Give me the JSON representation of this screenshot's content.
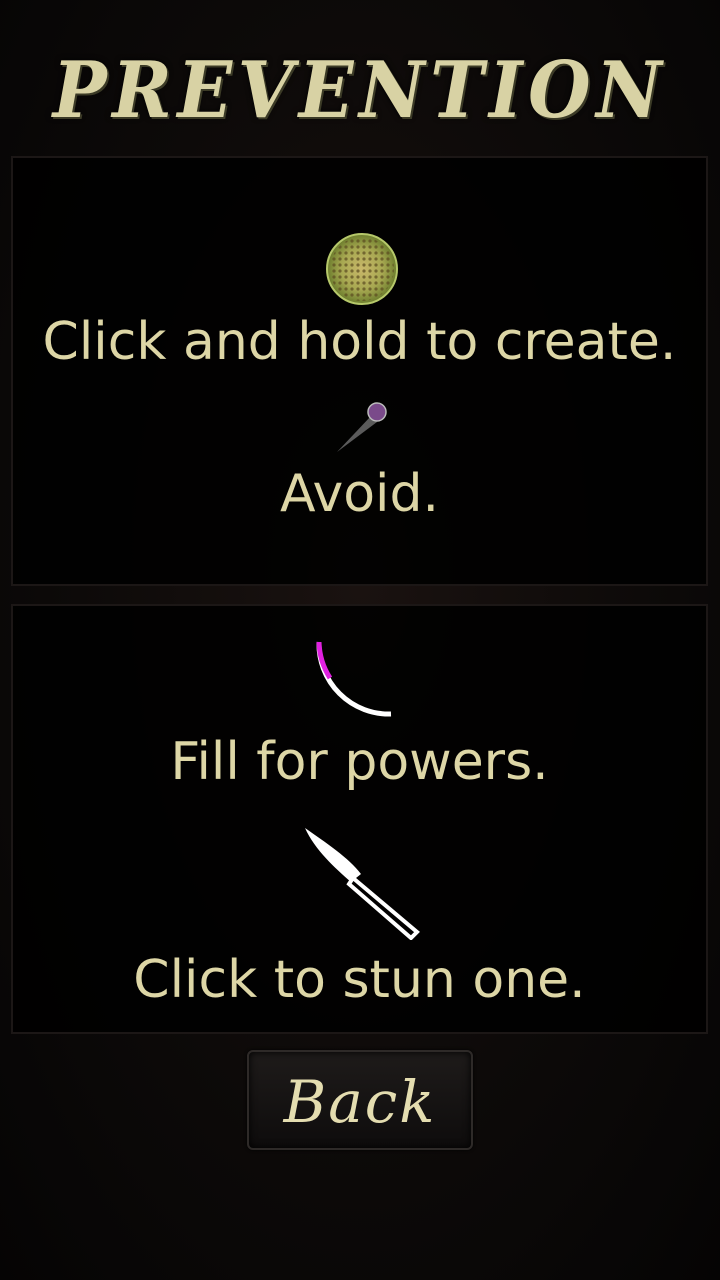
{
  "title": "Prevention",
  "title_display": "PREVENTION",
  "panels": [
    {
      "items": [
        {
          "icon": "cell-icon",
          "text": "Click and hold to create."
        },
        {
          "icon": "virus-icon",
          "text": "Avoid."
        }
      ]
    },
    {
      "items": [
        {
          "icon": "power-meter-icon",
          "text": "Fill for powers.",
          "fill_fraction": 0.3
        },
        {
          "icon": "scalpel-icon",
          "text": "Click to stun one."
        }
      ]
    }
  ],
  "back_button": {
    "label": "Back"
  },
  "colors": {
    "text": "#ddd6a6",
    "accent_magenta": "#e020e0",
    "background": "#0a0808"
  }
}
